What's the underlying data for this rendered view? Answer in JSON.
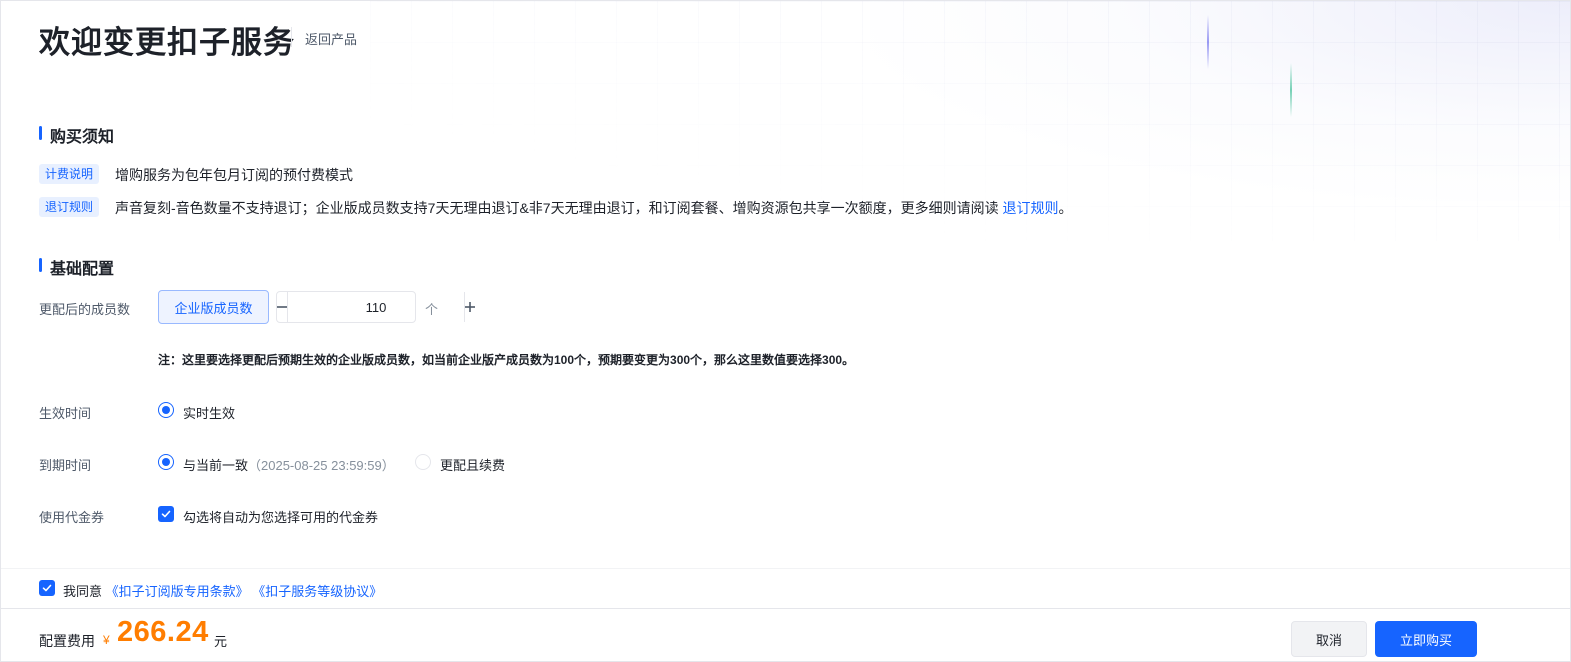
{
  "header": {
    "title": "欢迎变更扣子服务",
    "back_label": "返回产品"
  },
  "purchase_notes": {
    "heading": "购买须知",
    "billing": {
      "tag": "计费说明",
      "text": "增购服务为包年包月订阅的预付费模式"
    },
    "refund": {
      "tag": "退订规则",
      "text": "声音复刻-音色数量不支持退订；企业版成员数支持7天无理由退订&非7天无理由退订，和订阅套餐、增购资源包共享一次额度，更多细则请阅读 ",
      "link": "退订规则",
      "suffix": "。"
    }
  },
  "basic_config": {
    "heading": "基础配置",
    "members": {
      "label": "更配后的成员数",
      "option": "企业版成员数",
      "value": "110",
      "unit": "个",
      "minus": "−",
      "plus": "+"
    },
    "note": "注：这里要选择更配后预期生效的企业版成员数，如当前企业版产成员数为100个，预期要变更为300个，那么这里数值要选择300。",
    "effective_time": {
      "label": "生效时间",
      "option": "实时生效",
      "selected": true
    },
    "expiry_time": {
      "label": "到期时间",
      "option_same": "与当前一致",
      "option_same_date": "（2025-08-25 23:59:59）",
      "option_renew": "更配且续费",
      "selected": "same"
    },
    "voucher": {
      "label": "使用代金券",
      "text": "勾选将自动为您选择可用的代金券",
      "checked": true
    }
  },
  "agreement": {
    "checked": true,
    "prefix": "我同意",
    "terms": "《扣子订阅版专用条款》",
    "sla": "《扣子服务等级协议》"
  },
  "footer": {
    "fee_label": "配置费用",
    "currency": "¥",
    "price": "266.24",
    "unit": "元",
    "cancel": "取消",
    "buy": "立即购买"
  },
  "colors": {
    "accent": "#1664ff",
    "price": "#ff7d00",
    "tag_bg": "#e8f0ff"
  }
}
